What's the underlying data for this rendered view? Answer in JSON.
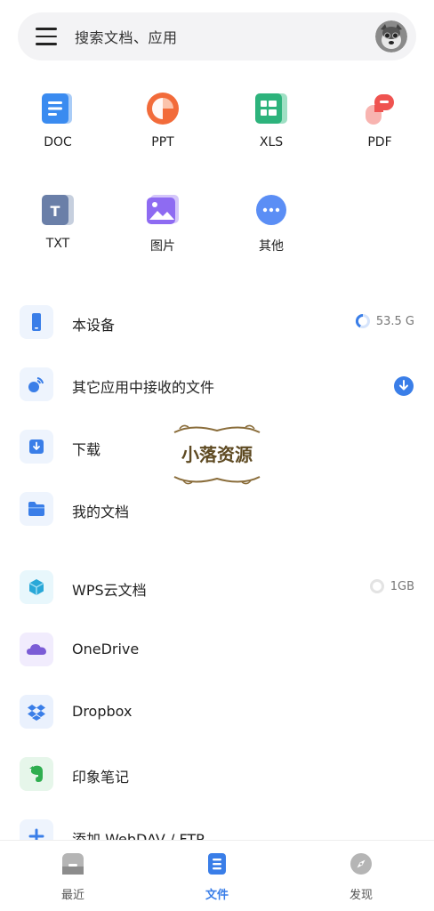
{
  "search": {
    "placeholder": "搜索文档、应用"
  },
  "categories": [
    {
      "label": "DOC",
      "icon": "doc-icon",
      "color": "#3a8bf0"
    },
    {
      "label": "PPT",
      "icon": "ppt-icon",
      "color": "#f26b3a"
    },
    {
      "label": "XLS",
      "icon": "xls-icon",
      "color": "#2db37c"
    },
    {
      "label": "PDF",
      "icon": "pdf-icon",
      "color": "#ef5350"
    },
    {
      "label": "TXT",
      "icon": "txt-icon",
      "color": "#6a7fa8"
    },
    {
      "label": "图片",
      "icon": "image-icon",
      "color": "#8e6bf2"
    },
    {
      "label": "其他",
      "icon": "more-icon",
      "color": "#5b8ef5"
    }
  ],
  "local": [
    {
      "label": "本设备",
      "icon": "phone-icon",
      "meta": "53.5 G"
    },
    {
      "label": "其它应用中接收的文件",
      "icon": "satellite-icon",
      "meta": ""
    },
    {
      "label": "下载",
      "icon": "download-icon",
      "meta": ""
    },
    {
      "label": "我的文档",
      "icon": "folder-icon",
      "meta": ""
    }
  ],
  "cloud": [
    {
      "label": "WPS云文档",
      "icon": "wps-cloud-icon",
      "meta": "1GB"
    },
    {
      "label": "OneDrive",
      "icon": "onedrive-icon",
      "meta": ""
    },
    {
      "label": "Dropbox",
      "icon": "dropbox-icon",
      "meta": ""
    },
    {
      "label": "印象笔记",
      "icon": "evernote-icon",
      "meta": ""
    },
    {
      "label": "添加 WebDAV / FTP",
      "icon": "add-icon",
      "meta": ""
    }
  ],
  "watermark": {
    "text": "小落资源"
  },
  "nav": [
    {
      "label": "最近",
      "icon": "recent-icon",
      "active": false
    },
    {
      "label": "文件",
      "icon": "files-icon",
      "active": true
    },
    {
      "label": "发现",
      "icon": "discover-icon",
      "active": false
    }
  ],
  "colors": {
    "accent": "#3a7ee8",
    "inactive": "#555555",
    "row_icon_bg": "#eef4fd"
  }
}
